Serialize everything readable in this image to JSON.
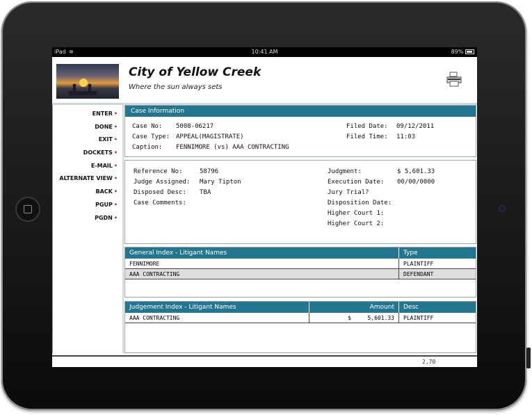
{
  "statusbar": {
    "device": "iPad",
    "time": "10:41 AM",
    "battery": "89%"
  },
  "header": {
    "title": "City of Yellow Creek",
    "subtitle": "Where the sun always sets"
  },
  "nav": [
    {
      "label": "ENTER"
    },
    {
      "label": "DONE"
    },
    {
      "label": "EXIT"
    },
    {
      "label": "DOCKETS"
    },
    {
      "label": "E-MAIL"
    },
    {
      "label": "ALTERNATE VIEW"
    },
    {
      "label": "BACK"
    },
    {
      "label": "PGUP"
    },
    {
      "label": "PGDN"
    }
  ],
  "case_info": {
    "heading": "Case Information",
    "case_no_label": "Case No:",
    "case_no": "5008-06217",
    "case_type_label": "Case Type:",
    "case_type": "APPEAL(MAGISTRATE)",
    "caption_label": "Caption:",
    "caption": "FENNIMORE (vs) AAA CONTRACTING",
    "filed_date_label": "Filed Date:",
    "filed_date": "09/12/2011",
    "filed_time_label": "Filed Time:",
    "filed_time": "11:03"
  },
  "details": {
    "reference_label": "Reference No:",
    "reference": "58796",
    "judge_label": "Judge Assigned:",
    "judge": "Mary Tipton",
    "disposed_label": "Disposed Desc:",
    "disposed": "TBA",
    "comments_label": "Case Comments:",
    "judgment_label": "Judgment:",
    "judgment": "$ 5,601.33",
    "execution_label": "Execution Date:",
    "execution": "00/00/0000",
    "jury_label": "Jury Trial?",
    "disposition_label": "Disposition Date:",
    "higher1_label": "Higher Court 1:",
    "higher2_label": "Higher Court 2:"
  },
  "general_index": {
    "heading": "General Index - Litigant Names",
    "type_heading": "Type",
    "rows": [
      {
        "name": "FENNIMORE",
        "type": "PLAINTIFF"
      },
      {
        "name": "AAA CONTRACTING",
        "type": "DEFENDANT"
      }
    ]
  },
  "judgement_index": {
    "heading": "Judgement Index - Litigant Names",
    "amount_heading": "Amount",
    "desc_heading": "Desc",
    "rows": [
      {
        "name": "AAA CONTRACTING",
        "currency": "$",
        "amount": "5,601.33",
        "desc": "PLAINTIFF"
      }
    ]
  },
  "footer": {
    "position": "2,70"
  },
  "colors": {
    "accent": "#23768f",
    "nav_dot": "#c0282d"
  }
}
